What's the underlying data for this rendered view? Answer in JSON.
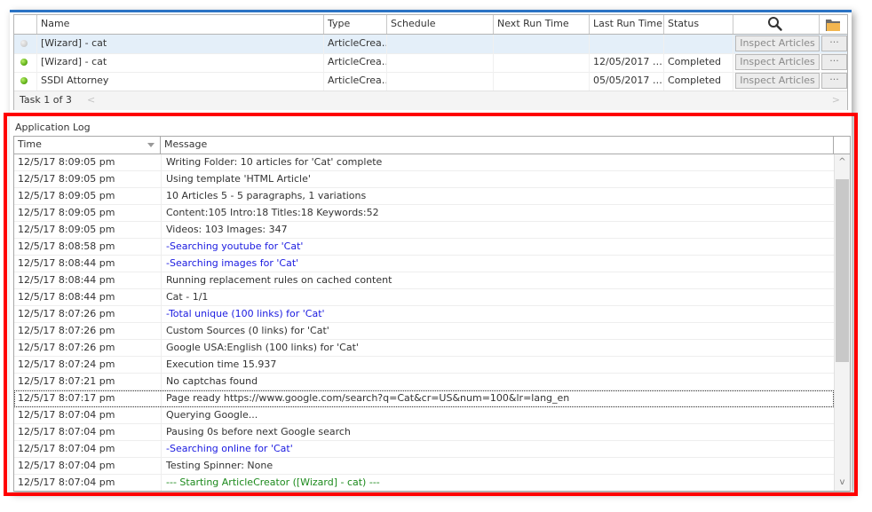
{
  "task_grid": {
    "columns": [
      "",
      "Name",
      "Type",
      "Schedule",
      "Next Run Time",
      "Last Run Time",
      "Status"
    ],
    "header_icons": {
      "search": "search-icon",
      "folder": "folder-icon"
    },
    "rows": [
      {
        "status_dot": "grey",
        "name": "[Wizard] - cat",
        "type": "ArticleCrea…",
        "schedule": "",
        "next_run": "",
        "last_run": "",
        "status": "",
        "inspect_label": "Inspect Articles",
        "more_label": "···",
        "selected": true
      },
      {
        "status_dot": "green",
        "name": "[Wizard] - cat",
        "type": "ArticleCrea…",
        "schedule": "",
        "next_run": "",
        "last_run": "12/05/2017 …",
        "status": "Completed",
        "inspect_label": "Inspect Articles",
        "more_label": "···",
        "selected": false
      },
      {
        "status_dot": "green",
        "name": "SSDI Attorney",
        "type": "ArticleCrea…",
        "schedule": "",
        "next_run": "",
        "last_run": "05/05/2017 …",
        "status": "Completed",
        "inspect_label": "Inspect Articles",
        "more_label": "···",
        "selected": false
      }
    ],
    "footer": {
      "count_text": "Task 1 of 3",
      "prev": "<",
      "next": ">"
    }
  },
  "log": {
    "title": "Application Log",
    "columns": {
      "time": "Time",
      "message": "Message"
    },
    "rows": [
      {
        "time": "12/5/17 8:09:05 pm",
        "message": "Writing Folder: 10 articles for 'Cat' complete",
        "color": "normal"
      },
      {
        "time": "12/5/17 8:09:05 pm",
        "message": "Using template 'HTML Article'",
        "color": "normal"
      },
      {
        "time": "12/5/17 8:09:05 pm",
        "message": "10 Articles 5 - 5 paragraphs, 1 variations",
        "color": "normal"
      },
      {
        "time": "12/5/17 8:09:05 pm",
        "message": "Content:105 Intro:18 Titles:18 Keywords:52",
        "color": "normal"
      },
      {
        "time": "12/5/17 8:09:05 pm",
        "message": "Videos: 103 Images: 347",
        "color": "normal"
      },
      {
        "time": "12/5/17 8:08:58 pm",
        "message": "-Searching youtube for 'Cat'",
        "color": "blue"
      },
      {
        "time": "12/5/17 8:08:44 pm",
        "message": "-Searching images for 'Cat'",
        "color": "blue"
      },
      {
        "time": "12/5/17 8:08:44 pm",
        "message": "Running replacement rules on cached content",
        "color": "normal"
      },
      {
        "time": "12/5/17 8:08:44 pm",
        "message": "Cat - 1/1",
        "color": "normal"
      },
      {
        "time": "12/5/17 8:07:26 pm",
        "message": "-Total unique (100 links) for 'Cat'",
        "color": "blue"
      },
      {
        "time": "12/5/17 8:07:26 pm",
        "message": "Custom Sources (0 links) for 'Cat'",
        "color": "normal"
      },
      {
        "time": "12/5/17 8:07:26 pm",
        "message": "Google USA:English (100 links) for 'Cat'",
        "color": "normal"
      },
      {
        "time": "12/5/17 8:07:24 pm",
        "message": "Execution time  15.937",
        "color": "normal"
      },
      {
        "time": "12/5/17 8:07:21 pm",
        "message": "No captchas found",
        "color": "normal"
      },
      {
        "time": "12/5/17 8:07:17 pm",
        "message": "Page ready https://www.google.com/search?q=Cat&cr=US&num=100&lr=lang_en",
        "color": "normal",
        "focused": true
      },
      {
        "time": "12/5/17 8:07:04 pm",
        "message": "Querying Google...",
        "color": "normal"
      },
      {
        "time": "12/5/17 8:07:04 pm",
        "message": "Pausing 0s before next Google search",
        "color": "normal"
      },
      {
        "time": "12/5/17 8:07:04 pm",
        "message": "-Searching online for 'Cat'",
        "color": "blue"
      },
      {
        "time": "12/5/17 8:07:04 pm",
        "message": "Testing Spinner: None",
        "color": "normal"
      },
      {
        "time": "12/5/17 8:07:04 pm",
        "message": "--- Starting ArticleCreator ([Wizard] - cat) ---",
        "color": "green"
      }
    ],
    "scrollbar": {
      "up": "^",
      "down": "v",
      "thumb_start_fraction": 0.03,
      "thumb_size_fraction": 0.6
    }
  },
  "colors": {
    "accent": "#2b73c4",
    "highlight": "#ff0000",
    "log_blue": "#1a1ae0",
    "log_green": "#1c8a1c",
    "selected_row": "#e4eff9"
  }
}
